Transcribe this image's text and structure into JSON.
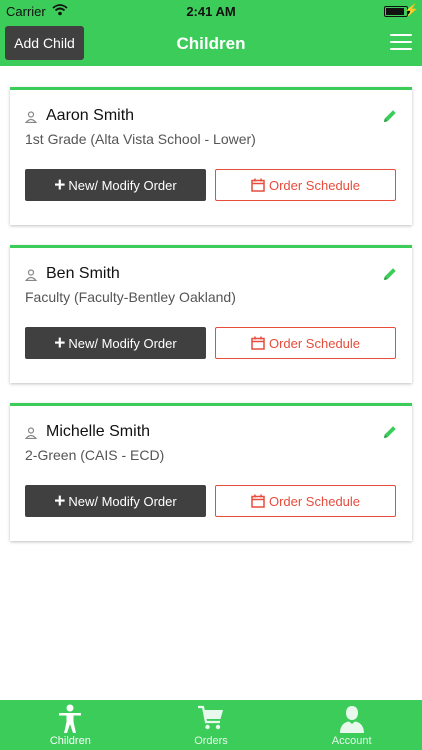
{
  "status": {
    "carrier": "Carrier",
    "time": "2:41 AM"
  },
  "header": {
    "add_child": "Add Child",
    "title": "Children"
  },
  "children": [
    {
      "name": "Aaron Smith",
      "school": "1st Grade (Alta Vista School - Lower)",
      "order_btn": "New/ Modify Order",
      "schedule_btn": "Order Schedule"
    },
    {
      "name": "Ben Smith",
      "school": "Faculty (Faculty-Bentley Oakland)",
      "order_btn": "New/ Modify Order",
      "schedule_btn": "Order Schedule"
    },
    {
      "name": "Michelle Smith",
      "school": "2-Green (CAIS - ECD)",
      "order_btn": "New/ Modify Order",
      "schedule_btn": "Order Schedule"
    }
  ],
  "tabs": [
    {
      "label": "Children",
      "icon": "child-icon"
    },
    {
      "label": "Orders",
      "icon": "cart-icon"
    },
    {
      "label": "Account",
      "icon": "account-icon"
    }
  ],
  "colors": {
    "brand_green": "#3ccc5a",
    "dark_button": "#404040",
    "accent_red": "#e74c3c"
  }
}
